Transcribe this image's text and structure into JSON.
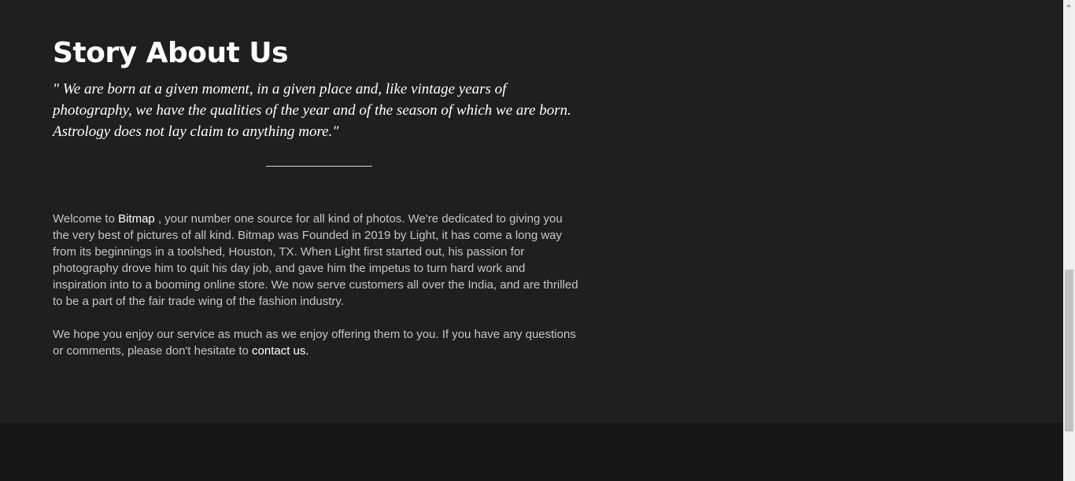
{
  "story": {
    "title": "Story About Us",
    "quote": "\" We are born at a given moment, in a given place and, like vintage years of photography, we have the qualities of the year and of the season of which we are born. Astrology does not lay claim to anything more.\"",
    "paragraph1": {
      "prefix": "Welcome to ",
      "brand_link": "Bitmap",
      "suffix": " , your number one source for all kind of photos. We're dedicated to giving you the very best of pictures of all kind. Bitmap was Founded in 2019 by Light, it has come a long way from its beginnings in a toolshed, Houston, TX. When Light first started out, his passion for photography drove him to quit his day job, and gave him the impetus to turn hard work and inspiration into to a booming online store. We now serve customers all over the India, and are thrilled to be a part of the fair trade wing of the fashion industry."
    },
    "paragraph2": {
      "text": "We hope you enjoy our service as much as we enjoy offering them to you. If you have any questions or comments, please don't hesitate to ",
      "contact_link": "contact us."
    }
  },
  "colors": {
    "background": "#1f1f1f",
    "footer": "#171717",
    "heading": "#ffffff",
    "body_text": "#c6c6c6",
    "link": "#ffffff"
  },
  "icons": {
    "scroll_up": "scroll-up-arrow-icon"
  }
}
